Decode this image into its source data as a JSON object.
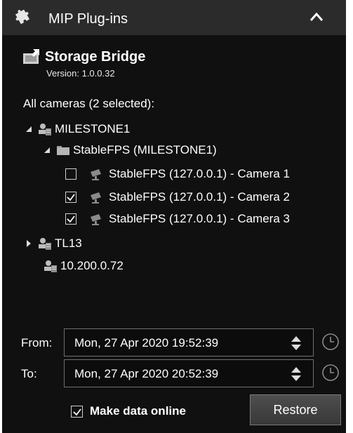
{
  "header": {
    "title": "MIP Plug-ins"
  },
  "plugin": {
    "name": "Storage Bridge",
    "version": "Version: 1.0.0.32"
  },
  "cameras": {
    "summary": "All cameras (2 selected):",
    "tree": {
      "server1": "MILESTONE1",
      "group1": "StableFPS (MILESTONE1)",
      "cameras": [
        {
          "label": "StableFPS (127.0.0.1) - Camera 1",
          "checked": false
        },
        {
          "label": "StableFPS (127.0.0.1) - Camera 2",
          "checked": true
        },
        {
          "label": "StableFPS (127.0.0.1) - Camera 3",
          "checked": true
        }
      ],
      "server2": "TL13",
      "server3": "10.200.0.72"
    }
  },
  "range": {
    "from_label": "From:",
    "from_value": "Mon, 27 Apr 2020 19:52:39",
    "to_label": "To:",
    "to_value": "Mon, 27 Apr 2020 20:52:39"
  },
  "actions": {
    "make_online_label": "Make data online",
    "make_online_checked": true,
    "restore_label": "Restore"
  }
}
